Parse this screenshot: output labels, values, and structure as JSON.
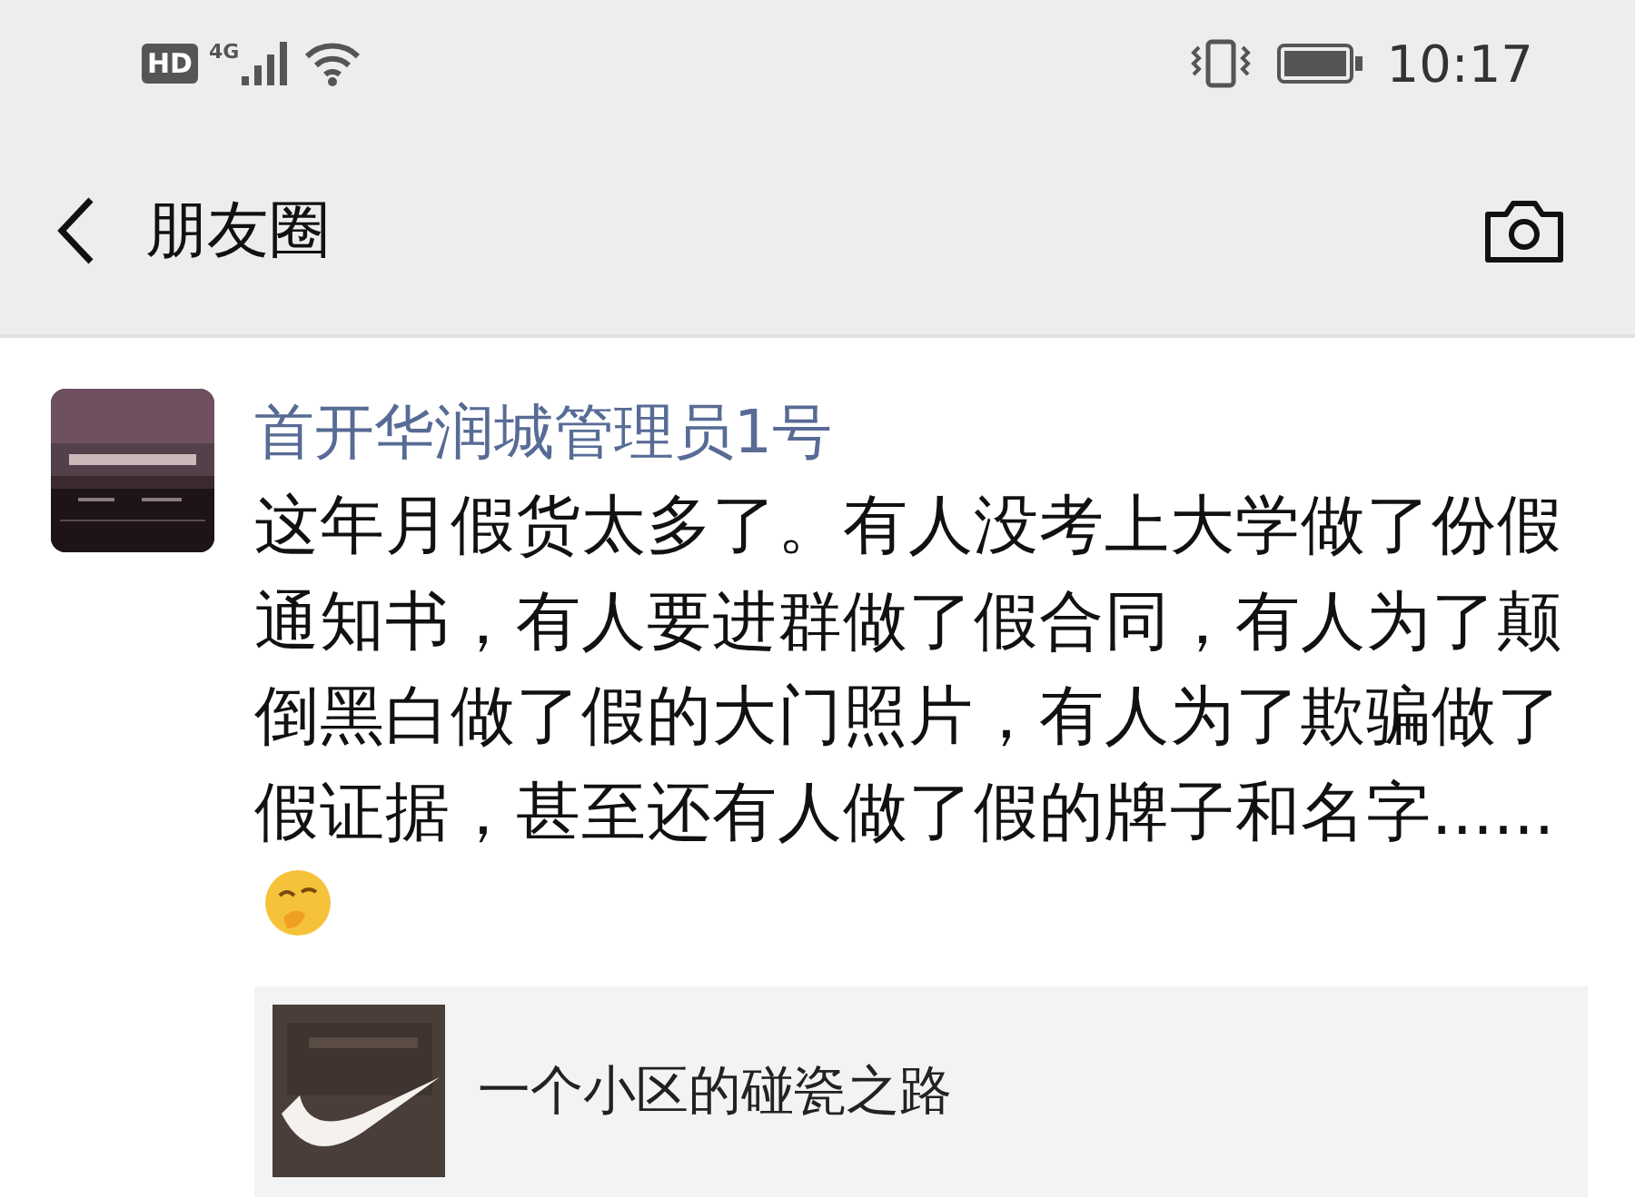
{
  "status_bar": {
    "hd": "HD",
    "network": "4G",
    "time": "10:17"
  },
  "nav": {
    "title": "朋友圈"
  },
  "post": {
    "author": "首开华润城管理员1号",
    "text": "这年月假货太多了。有人没考上大学做了份假通知书，有人要进群做了假合同，有人为了颠倒黑白做了假的大门照片，有人为了欺骗做了假证据，甚至还有人做了假的牌子和名字......",
    "link": {
      "title": "一个小区的碰瓷之路"
    }
  }
}
